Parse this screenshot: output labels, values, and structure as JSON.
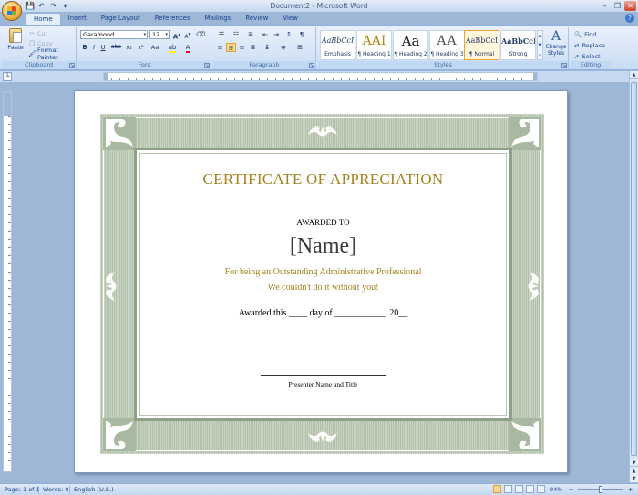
{
  "window": {
    "title": "Document2 - Microsoft Word",
    "controls": [
      "–",
      "❐",
      "✕"
    ]
  },
  "quick_access": [
    "save-icon",
    "undo-icon",
    "redo-icon",
    "customize-icon"
  ],
  "tabs": [
    {
      "label": "Home",
      "active": true
    },
    {
      "label": "Insert"
    },
    {
      "label": "Page Layout"
    },
    {
      "label": "References"
    },
    {
      "label": "Mailings"
    },
    {
      "label": "Review"
    },
    {
      "label": "View"
    }
  ],
  "ribbon": {
    "clipboard": {
      "label": "Clipboard",
      "paste": "Paste",
      "cut": "Cut",
      "copy": "Copy",
      "format_painter": "Format Painter"
    },
    "font": {
      "label": "Font",
      "family": "Garamond",
      "size": "12",
      "bold": "B",
      "italic": "I",
      "underline": "U",
      "strike": "abe",
      "subscript": "x₂",
      "superscript": "x²",
      "change_case": "Aa",
      "grow": "A",
      "shrink": "A",
      "font_color": "A"
    },
    "paragraph": {
      "label": "Paragraph"
    },
    "styles": {
      "label": "Styles",
      "items": [
        {
          "sample": "AaBbCcI",
          "name": "Emphasis"
        },
        {
          "sample": "AAI",
          "name": "¶ Heading 1"
        },
        {
          "sample": "Aa",
          "name": "¶ Heading 2"
        },
        {
          "sample": "AA",
          "name": "¶ Heading 3"
        },
        {
          "sample": "AaBbCcI",
          "name": "¶ Normal"
        },
        {
          "sample": "AaBbCcI",
          "name": "Strong"
        }
      ],
      "change_styles": "Change Styles"
    },
    "editing": {
      "label": "Editing",
      "find": "Find",
      "replace": "Replace",
      "select": "Select"
    }
  },
  "certificate": {
    "title": "CERTIFICATE OF APPRECIATION",
    "awarded_to": "AWARDED TO",
    "name": "[Name]",
    "reason_line1": "For being an Outstanding Administrative Professional",
    "reason_line2": "We couldn't do it without you!",
    "date_line": "Awarded this ____ day of ___________, 20__",
    "signature_label": "Presenter Name and Title"
  },
  "status": {
    "page": "Page: 1 of 1",
    "words": "Words: 0",
    "language": "English (U.S.)",
    "zoom": "94%"
  },
  "colors": {
    "accent_gold": "#a5821e",
    "border_green": "#8ea187",
    "ribbon_blue": "#15428b"
  }
}
